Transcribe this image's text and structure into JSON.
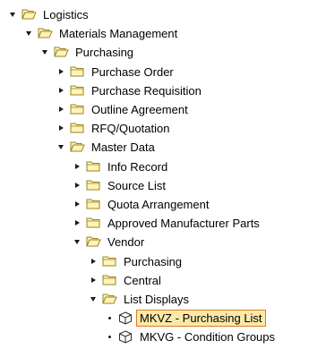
{
  "tree": {
    "nodes": [
      {
        "label": "Logistics",
        "level": 0,
        "toggle": "expanded",
        "icon": "folder-open-icon"
      },
      {
        "label": "Materials Management",
        "level": 1,
        "toggle": "expanded",
        "icon": "folder-open-icon"
      },
      {
        "label": "Purchasing",
        "level": 2,
        "toggle": "expanded",
        "icon": "folder-open-icon"
      },
      {
        "label": "Purchase Order",
        "level": 3,
        "toggle": "collapsed",
        "icon": "folder-closed-icon"
      },
      {
        "label": "Purchase Requisition",
        "level": 3,
        "toggle": "collapsed",
        "icon": "folder-closed-icon"
      },
      {
        "label": "Outline Agreement",
        "level": 3,
        "toggle": "collapsed",
        "icon": "folder-closed-icon"
      },
      {
        "label": "RFQ/Quotation",
        "level": 3,
        "toggle": "collapsed",
        "icon": "folder-closed-icon"
      },
      {
        "label": "Master Data",
        "level": 3,
        "toggle": "expanded",
        "icon": "folder-open-icon"
      },
      {
        "label": "Info Record",
        "level": 4,
        "toggle": "collapsed",
        "icon": "folder-closed-icon"
      },
      {
        "label": "Source List",
        "level": 4,
        "toggle": "collapsed",
        "icon": "folder-closed-icon"
      },
      {
        "label": "Quota Arrangement",
        "level": 4,
        "toggle": "collapsed",
        "icon": "folder-closed-icon"
      },
      {
        "label": "Approved Manufacturer Parts",
        "level": 4,
        "toggle": "collapsed",
        "icon": "folder-closed-icon"
      },
      {
        "label": "Vendor",
        "level": 4,
        "toggle": "expanded",
        "icon": "folder-open-icon"
      },
      {
        "label": "Purchasing",
        "level": 5,
        "toggle": "collapsed",
        "icon": "folder-closed-icon"
      },
      {
        "label": "Central",
        "level": 5,
        "toggle": "collapsed",
        "icon": "folder-closed-icon"
      },
      {
        "label": "List Displays",
        "level": 5,
        "toggle": "expanded",
        "icon": "folder-open-icon"
      },
      {
        "label": "MKVZ - Purchasing List",
        "level": 6,
        "toggle": "leaf",
        "icon": "transaction-cube-icon",
        "selected": true
      },
      {
        "label": "MKVG - Condition Groups",
        "level": 6,
        "toggle": "leaf",
        "icon": "transaction-cube-icon"
      }
    ]
  },
  "colors": {
    "folder_fill": "#fff4b8",
    "folder_stroke": "#9a8420",
    "selection_fill": "#fbe9a8",
    "selection_border": "#e07a1f",
    "toggle": "#1b1b1b"
  }
}
